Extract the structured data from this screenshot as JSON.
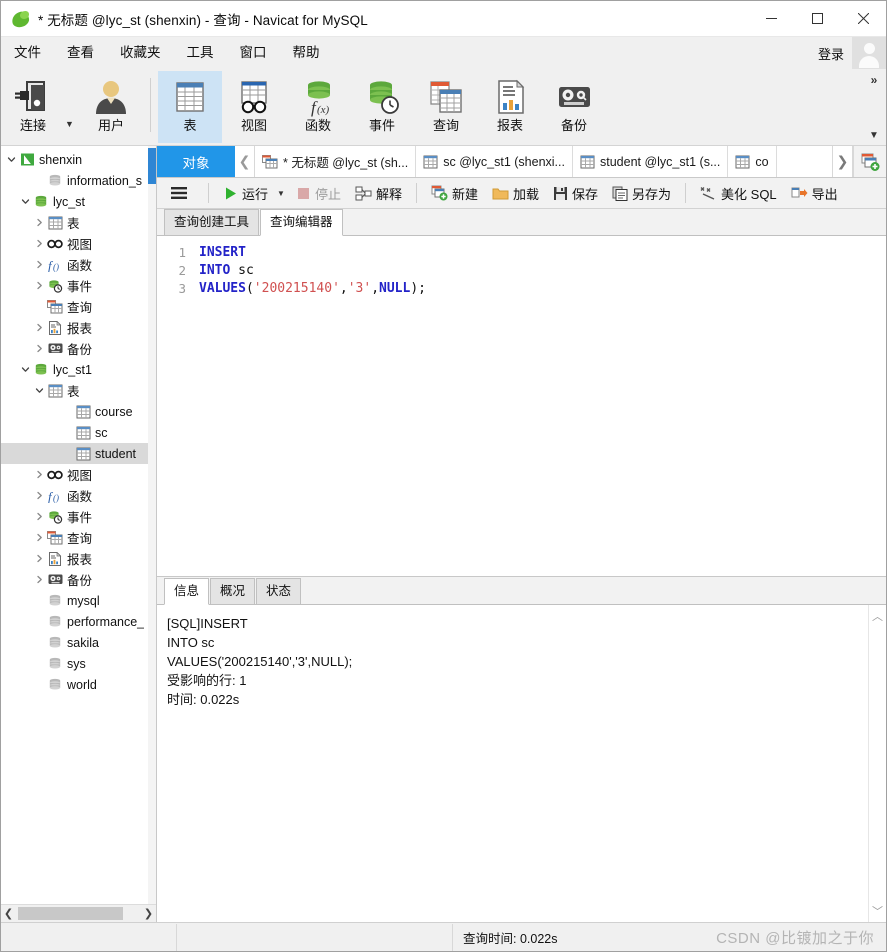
{
  "window": {
    "title": "* 无标题 @lyc_st (shenxin) - 查询 - Navicat for MySQL",
    "minimize": "—",
    "maximize": "□",
    "close": "✕"
  },
  "menubar": {
    "items": [
      {
        "label": "文件"
      },
      {
        "label": "查看"
      },
      {
        "label": "收藏夹"
      },
      {
        "label": "工具"
      },
      {
        "label": "窗口"
      },
      {
        "label": "帮助"
      }
    ],
    "login_label": "登录"
  },
  "toolbar": {
    "buttons": [
      {
        "label": "连接",
        "icon": "connection-icon",
        "has_caret": true,
        "active": false
      },
      {
        "label": "用户",
        "icon": "user-icon",
        "has_caret": false,
        "active": false
      },
      {
        "label": "表",
        "icon": "table-icon",
        "has_caret": false,
        "active": true
      },
      {
        "label": "视图",
        "icon": "view-icon",
        "has_caret": false,
        "active": false
      },
      {
        "label": "函数",
        "icon": "function-icon",
        "has_caret": false,
        "active": false
      },
      {
        "label": "事件",
        "icon": "event-icon",
        "has_caret": false,
        "active": false
      },
      {
        "label": "查询",
        "icon": "query-icon",
        "has_caret": false,
        "active": false
      },
      {
        "label": "报表",
        "icon": "report-icon",
        "has_caret": false,
        "active": false
      },
      {
        "label": "备份",
        "icon": "backup-icon",
        "has_caret": false,
        "active": false
      }
    ],
    "overflow": "»"
  },
  "sidebar": {
    "tree": [
      {
        "label": "shenxin",
        "indent": 0,
        "icon": "connection-green-icon",
        "arrow": "down",
        "selected": false
      },
      {
        "label": "information_s",
        "indent": 2,
        "icon": "database-gray-icon",
        "arrow": "none",
        "selected": false
      },
      {
        "label": "lyc_st",
        "indent": 1,
        "icon": "database-green-icon",
        "arrow": "down",
        "selected": false
      },
      {
        "label": "表",
        "indent": 2,
        "icon": "table-icon",
        "arrow": "right",
        "selected": false
      },
      {
        "label": "视图",
        "indent": 2,
        "icon": "view-icon",
        "arrow": "right",
        "selected": false
      },
      {
        "label": "函数",
        "indent": 2,
        "icon": "function-icon",
        "arrow": "right",
        "selected": false
      },
      {
        "label": "事件",
        "indent": 2,
        "icon": "event-icon",
        "arrow": "right",
        "selected": false
      },
      {
        "label": "查询",
        "indent": 2,
        "icon": "query-icon",
        "arrow": "none",
        "selected": false
      },
      {
        "label": "报表",
        "indent": 2,
        "icon": "report-icon",
        "arrow": "right",
        "selected": false
      },
      {
        "label": "备份",
        "indent": 2,
        "icon": "backup-icon",
        "arrow": "right",
        "selected": false
      },
      {
        "label": "lyc_st1",
        "indent": 1,
        "icon": "database-green-icon",
        "arrow": "down",
        "selected": false
      },
      {
        "label": "表",
        "indent": 2,
        "icon": "table-icon",
        "arrow": "down",
        "selected": false
      },
      {
        "label": "course",
        "indent": 4,
        "icon": "table-icon",
        "arrow": "none",
        "selected": false
      },
      {
        "label": "sc",
        "indent": 4,
        "icon": "table-icon",
        "arrow": "none",
        "selected": false
      },
      {
        "label": "student",
        "indent": 4,
        "icon": "table-icon",
        "arrow": "none",
        "selected": true
      },
      {
        "label": "视图",
        "indent": 2,
        "icon": "view-icon",
        "arrow": "right",
        "selected": false
      },
      {
        "label": "函数",
        "indent": 2,
        "icon": "function-icon",
        "arrow": "right",
        "selected": false
      },
      {
        "label": "事件",
        "indent": 2,
        "icon": "event-icon",
        "arrow": "right",
        "selected": false
      },
      {
        "label": "查询",
        "indent": 2,
        "icon": "query-icon",
        "arrow": "right",
        "selected": false
      },
      {
        "label": "报表",
        "indent": 2,
        "icon": "report-icon",
        "arrow": "right",
        "selected": false
      },
      {
        "label": "备份",
        "indent": 2,
        "icon": "backup-icon",
        "arrow": "right",
        "selected": false
      },
      {
        "label": "mysql",
        "indent": 2,
        "icon": "database-gray-icon",
        "arrow": "none",
        "selected": false
      },
      {
        "label": "performance_",
        "indent": 2,
        "icon": "database-gray-icon",
        "arrow": "none",
        "selected": false
      },
      {
        "label": "sakila",
        "indent": 2,
        "icon": "database-gray-icon",
        "arrow": "none",
        "selected": false
      },
      {
        "label": "sys",
        "indent": 2,
        "icon": "database-gray-icon",
        "arrow": "none",
        "selected": false
      },
      {
        "label": "world",
        "indent": 2,
        "icon": "database-gray-icon",
        "arrow": "none",
        "selected": false
      }
    ],
    "scroll_left": "❮",
    "scroll_right": "❯"
  },
  "tabstrip": {
    "object_tab": "对象",
    "nav_prev": "❮",
    "nav_next": "❯",
    "documents": [
      {
        "label": "* 无标题 @lyc_st (sh...",
        "icon": "query-icon",
        "active": true
      },
      {
        "label": "sc @lyc_st1 (shenxi...",
        "icon": "table-icon",
        "active": false
      },
      {
        "label": "student @lyc_st1 (s...",
        "icon": "table-icon",
        "active": false
      },
      {
        "label": "co",
        "icon": "table-icon",
        "active": false
      }
    ],
    "add_tab": "new-tab-icon"
  },
  "query_toolbar": {
    "menu_icon": "hamburger-icon",
    "buttons": [
      {
        "label": "运行",
        "icon": "run-icon",
        "disabled": false,
        "caret": true
      },
      {
        "label": "停止",
        "icon": "stop-icon",
        "disabled": true,
        "caret": false
      },
      {
        "label": "解释",
        "icon": "explain-icon",
        "disabled": false,
        "caret": false
      },
      {
        "label": "新建",
        "icon": "new-query-icon",
        "disabled": false,
        "caret": false
      },
      {
        "label": "加载",
        "icon": "load-icon",
        "disabled": false,
        "caret": false
      },
      {
        "label": "保存",
        "icon": "save-icon",
        "disabled": false,
        "caret": false
      },
      {
        "label": "另存为",
        "icon": "save-as-icon",
        "disabled": false,
        "caret": false
      },
      {
        "label": "美化 SQL",
        "icon": "beautify-icon",
        "disabled": false,
        "caret": false
      },
      {
        "label": "导出",
        "icon": "export-icon",
        "disabled": false,
        "caret": false
      }
    ]
  },
  "editor": {
    "tabs": [
      {
        "label": "查询创建工具",
        "active": false
      },
      {
        "label": "查询编辑器",
        "active": true
      }
    ],
    "line_numbers": [
      "1",
      "2",
      "3"
    ],
    "sql_lines": [
      [
        {
          "t": "INSERT",
          "c": "kw"
        }
      ],
      [
        {
          "t": "INTO",
          "c": "kw"
        },
        {
          "t": " ",
          "c": "pl"
        },
        {
          "t": "sc",
          "c": "pl"
        }
      ],
      [
        {
          "t": "VALUES",
          "c": "kw"
        },
        {
          "t": "(",
          "c": "pl"
        },
        {
          "t": "'200215140'",
          "c": "str"
        },
        {
          "t": ",",
          "c": "pl"
        },
        {
          "t": "'3'",
          "c": "str"
        },
        {
          "t": ",",
          "c": "pl"
        },
        {
          "t": "NULL",
          "c": "kw"
        },
        {
          "t": ");",
          "c": "pl"
        }
      ]
    ]
  },
  "results": {
    "tabs": [
      {
        "label": "信息",
        "active": true
      },
      {
        "label": "概况",
        "active": false
      },
      {
        "label": "状态",
        "active": false
      }
    ],
    "message_lines": [
      "[SQL]INSERT",
      "INTO sc",
      "VALUES('200215140','3',NULL);",
      "受影响的行: 1",
      "时间: 0.022s"
    ],
    "scroll_up": "︿",
    "scroll_down": "﹀"
  },
  "statusbar": {
    "query_time": "查询时间: 0.022s",
    "watermark": "CSDN @比镀加之于你"
  },
  "colors": {
    "accent_blue": "#2196e8",
    "toolbar_active": "#cde3f5",
    "tree_selection": "#d9d9d9",
    "keyword": "#2323c8",
    "string": "#d05050",
    "scroll_thumb": "#2f86d4"
  }
}
